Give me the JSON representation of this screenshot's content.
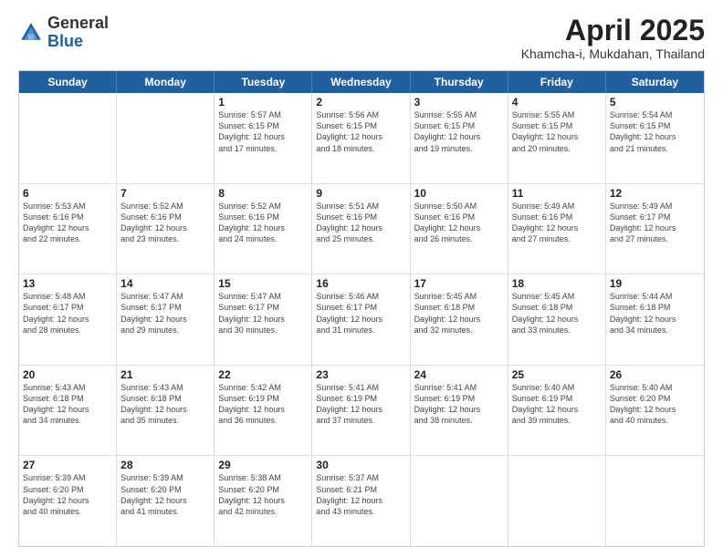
{
  "logo": {
    "general": "General",
    "blue": "Blue"
  },
  "header": {
    "month": "April 2025",
    "location": "Khamcha-i, Mukdahan, Thailand"
  },
  "days": [
    "Sunday",
    "Monday",
    "Tuesday",
    "Wednesday",
    "Thursday",
    "Friday",
    "Saturday"
  ],
  "weeks": [
    [
      {
        "day": "",
        "detail": ""
      },
      {
        "day": "",
        "detail": ""
      },
      {
        "day": "1",
        "detail": "Sunrise: 5:57 AM\nSunset: 6:15 PM\nDaylight: 12 hours\nand 17 minutes."
      },
      {
        "day": "2",
        "detail": "Sunrise: 5:56 AM\nSunset: 6:15 PM\nDaylight: 12 hours\nand 18 minutes."
      },
      {
        "day": "3",
        "detail": "Sunrise: 5:55 AM\nSunset: 6:15 PM\nDaylight: 12 hours\nand 19 minutes."
      },
      {
        "day": "4",
        "detail": "Sunrise: 5:55 AM\nSunset: 6:15 PM\nDaylight: 12 hours\nand 20 minutes."
      },
      {
        "day": "5",
        "detail": "Sunrise: 5:54 AM\nSunset: 6:15 PM\nDaylight: 12 hours\nand 21 minutes."
      }
    ],
    [
      {
        "day": "6",
        "detail": "Sunrise: 5:53 AM\nSunset: 6:16 PM\nDaylight: 12 hours\nand 22 minutes."
      },
      {
        "day": "7",
        "detail": "Sunrise: 5:52 AM\nSunset: 6:16 PM\nDaylight: 12 hours\nand 23 minutes."
      },
      {
        "day": "8",
        "detail": "Sunrise: 5:52 AM\nSunset: 6:16 PM\nDaylight: 12 hours\nand 24 minutes."
      },
      {
        "day": "9",
        "detail": "Sunrise: 5:51 AM\nSunset: 6:16 PM\nDaylight: 12 hours\nand 25 minutes."
      },
      {
        "day": "10",
        "detail": "Sunrise: 5:50 AM\nSunset: 6:16 PM\nDaylight: 12 hours\nand 26 minutes."
      },
      {
        "day": "11",
        "detail": "Sunrise: 5:49 AM\nSunset: 6:16 PM\nDaylight: 12 hours\nand 27 minutes."
      },
      {
        "day": "12",
        "detail": "Sunrise: 5:49 AM\nSunset: 6:17 PM\nDaylight: 12 hours\nand 27 minutes."
      }
    ],
    [
      {
        "day": "13",
        "detail": "Sunrise: 5:48 AM\nSunset: 6:17 PM\nDaylight: 12 hours\nand 28 minutes."
      },
      {
        "day": "14",
        "detail": "Sunrise: 5:47 AM\nSunset: 6:17 PM\nDaylight: 12 hours\nand 29 minutes."
      },
      {
        "day": "15",
        "detail": "Sunrise: 5:47 AM\nSunset: 6:17 PM\nDaylight: 12 hours\nand 30 minutes."
      },
      {
        "day": "16",
        "detail": "Sunrise: 5:46 AM\nSunset: 6:17 PM\nDaylight: 12 hours\nand 31 minutes."
      },
      {
        "day": "17",
        "detail": "Sunrise: 5:45 AM\nSunset: 6:18 PM\nDaylight: 12 hours\nand 32 minutes."
      },
      {
        "day": "18",
        "detail": "Sunrise: 5:45 AM\nSunset: 6:18 PM\nDaylight: 12 hours\nand 33 minutes."
      },
      {
        "day": "19",
        "detail": "Sunrise: 5:44 AM\nSunset: 6:18 PM\nDaylight: 12 hours\nand 34 minutes."
      }
    ],
    [
      {
        "day": "20",
        "detail": "Sunrise: 5:43 AM\nSunset: 6:18 PM\nDaylight: 12 hours\nand 34 minutes."
      },
      {
        "day": "21",
        "detail": "Sunrise: 5:43 AM\nSunset: 6:18 PM\nDaylight: 12 hours\nand 35 minutes."
      },
      {
        "day": "22",
        "detail": "Sunrise: 5:42 AM\nSunset: 6:19 PM\nDaylight: 12 hours\nand 36 minutes."
      },
      {
        "day": "23",
        "detail": "Sunrise: 5:41 AM\nSunset: 6:19 PM\nDaylight: 12 hours\nand 37 minutes."
      },
      {
        "day": "24",
        "detail": "Sunrise: 5:41 AM\nSunset: 6:19 PM\nDaylight: 12 hours\nand 38 minutes."
      },
      {
        "day": "25",
        "detail": "Sunrise: 5:40 AM\nSunset: 6:19 PM\nDaylight: 12 hours\nand 39 minutes."
      },
      {
        "day": "26",
        "detail": "Sunrise: 5:40 AM\nSunset: 6:20 PM\nDaylight: 12 hours\nand 40 minutes."
      }
    ],
    [
      {
        "day": "27",
        "detail": "Sunrise: 5:39 AM\nSunset: 6:20 PM\nDaylight: 12 hours\nand 40 minutes."
      },
      {
        "day": "28",
        "detail": "Sunrise: 5:39 AM\nSunset: 6:20 PM\nDaylight: 12 hours\nand 41 minutes."
      },
      {
        "day": "29",
        "detail": "Sunrise: 5:38 AM\nSunset: 6:20 PM\nDaylight: 12 hours\nand 42 minutes."
      },
      {
        "day": "30",
        "detail": "Sunrise: 5:37 AM\nSunset: 6:21 PM\nDaylight: 12 hours\nand 43 minutes."
      },
      {
        "day": "",
        "detail": ""
      },
      {
        "day": "",
        "detail": ""
      },
      {
        "day": "",
        "detail": ""
      }
    ]
  ]
}
